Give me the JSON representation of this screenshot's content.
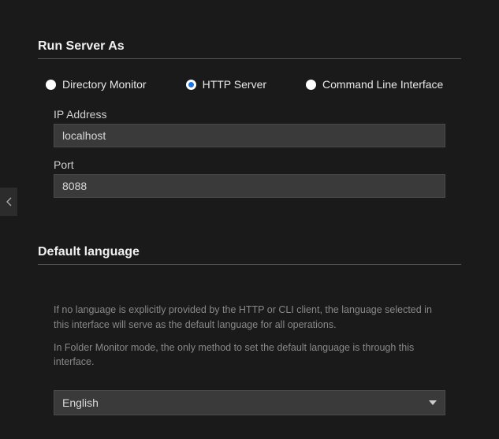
{
  "sections": {
    "run_server": {
      "title": "Run Server As",
      "options": [
        {
          "label": "Directory Monitor",
          "selected": false
        },
        {
          "label": "HTTP Server",
          "selected": true
        },
        {
          "label": "Command Line Interface",
          "selected": false
        }
      ],
      "ip_label": "IP Address",
      "ip_value": "localhost",
      "port_label": "Port",
      "port_value": "8088"
    },
    "default_lang": {
      "title": "Default language",
      "help1": "If no language is explicitly provided by the HTTP or CLI client, the language selected in this interface will serve as the default language for all operations.",
      "help2": "In Folder Monitor mode, the only method to set the default language is through this interface.",
      "selected": "English"
    }
  }
}
